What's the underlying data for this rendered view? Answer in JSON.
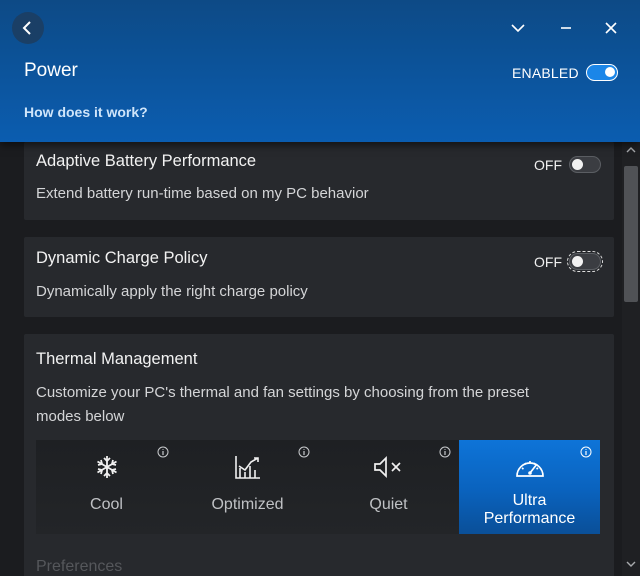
{
  "header": {
    "title": "Power",
    "link": "How does it work?",
    "enabled_label": "ENABLED",
    "enabled_state": true
  },
  "window_controls": [
    "back-icon",
    "chevron-down-icon",
    "minimize-icon",
    "close-icon"
  ],
  "cards": [
    {
      "title": "Adaptive Battery Performance",
      "description": "Extend battery run-time based on my PC behavior",
      "state_label": "OFF",
      "enabled": false
    },
    {
      "title": "Dynamic Charge Policy",
      "description": "Dynamically apply the right charge policy",
      "state_label": "OFF",
      "enabled": false,
      "focused": true
    },
    {
      "title": "Thermal Management",
      "description": "Customize your PC's thermal and fan settings by choosing from the preset modes below"
    }
  ],
  "thermal_modes": [
    {
      "label": "Cool",
      "icon": "snowflake-icon",
      "selected": false
    },
    {
      "label": "Optimized",
      "icon": "chart-icon",
      "selected": false
    },
    {
      "label": "Quiet",
      "icon": "speaker-mute-icon",
      "selected": false
    },
    {
      "label_line1": "Ultra",
      "label_line2": "Performance",
      "icon": "speedometer-icon",
      "selected": true
    }
  ],
  "next_section_partial": "Preferences",
  "colors": {
    "header_start": "#0d4a86",
    "header_end": "#0b5db0",
    "accent": "#0e74d8",
    "card_bg": "#27292d",
    "page_bg": "#1b1c1f"
  }
}
